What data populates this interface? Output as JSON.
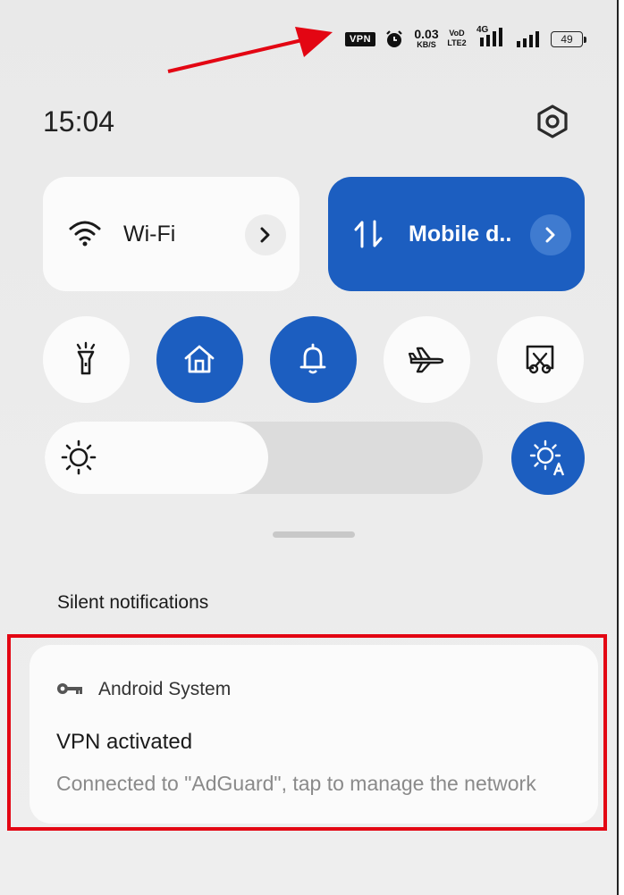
{
  "status_bar": {
    "vpn_label": "VPN",
    "net_speed_value": "0.03",
    "net_speed_unit": "KB/S",
    "volte_label_top": "VoD",
    "volte_label_bottom": "LTE2",
    "network_type": "4G",
    "battery": "49",
    "icons": [
      "alarm-icon",
      "signal-icon",
      "signal-icon"
    ]
  },
  "header": {
    "time": "15:04"
  },
  "tiles": {
    "wifi": {
      "label": "Wi-Fi",
      "active": false
    },
    "mobile_data": {
      "label": "Mobile d..",
      "active": true
    }
  },
  "quick_toggles": [
    {
      "name": "flashlight",
      "icon": "flashlight-icon",
      "active": false
    },
    {
      "name": "home",
      "icon": "home-icon",
      "active": true
    },
    {
      "name": "sound",
      "icon": "bell-icon",
      "active": true
    },
    {
      "name": "airplane-mode",
      "icon": "airplane-icon",
      "active": false
    },
    {
      "name": "screenshot",
      "icon": "scissors-icon",
      "active": false
    }
  ],
  "brightness": {
    "level_percent": 51,
    "auto": true
  },
  "notifications": {
    "section_title": "Silent notifications",
    "items": [
      {
        "app": "Android System",
        "title": "VPN activated",
        "text": "Connected to \"AdGuard\", tap to manage the network"
      }
    ]
  },
  "colors": {
    "accent": "#1c5ec0",
    "tile_off": "#fbfbfb",
    "annotation": "#e30613"
  }
}
